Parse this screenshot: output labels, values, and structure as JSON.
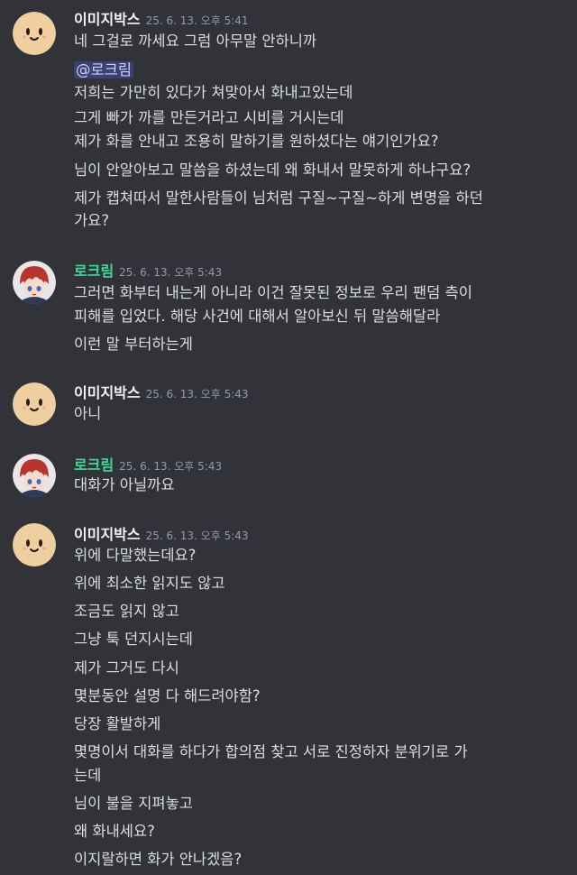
{
  "messages": [
    {
      "author": "이미지박스",
      "timestamp": "25. 6. 13. 오후 5:41",
      "mention": "@로크림",
      "lines": [
        "네 그걸로 까세요 그럼 아무말 안하니까",
        "저희는 가만히 있다가 쳐맞아서 화내고있는데",
        "그게 빠가 까를 만든거라고 시비를 거시는데",
        "제가 화를 안내고 조용히 말하기를 원하셨다는 얘기인가요?",
        "님이 안알아보고 말씀을 하셨는데 왜 화내서 말못하게 하냐구요?",
        "제가 캡쳐따서 말한사람들이 님처럼 구질~구질~하게 변명을 하던",
        "가요?"
      ]
    },
    {
      "author": "로크림",
      "timestamp": "25. 6. 13. 오후 5:43",
      "lines": [
        "그러면 화부터 내는게 아니라 이건 잘못된 정보로 우리 팬덤 측이",
        "피해를 입었다. 해당 사건에 대해서 알아보신 뒤 말씀해달라",
        "이런 말 부터하는게"
      ]
    },
    {
      "author": "이미지박스",
      "timestamp": "25. 6. 13. 오후 5:43",
      "lines": [
        "아니"
      ]
    },
    {
      "author": "로크림",
      "timestamp": "25. 6. 13. 오후 5:43",
      "lines": [
        "대화가 아닐까요"
      ]
    },
    {
      "author": "이미지박스",
      "timestamp": "25. 6. 13. 오후 5:43",
      "lines": [
        "위에 다말했는데요?",
        "위에 최소한 읽지도 않고",
        "조금도 읽지 않고",
        "그냥 툭 던지시는데",
        "제가 그거도 다시",
        "몇분동안 설명 다 해드려야함?",
        "당장 활발하게",
        "몇명이서 대화를 하다가 합의점 찾고 서로 진정하자 분위기로 가",
        "는데",
        "님이 불을 지펴놓고",
        "왜 화내세요?",
        "이지랄하면 화가 안나겠음?"
      ]
    }
  ],
  "colors": {
    "background": "#313338",
    "username_imagebox": "#f2f3f5",
    "username_rocream": "#3ddc97",
    "text": "#dbdee1",
    "timestamp": "#949ba4"
  }
}
